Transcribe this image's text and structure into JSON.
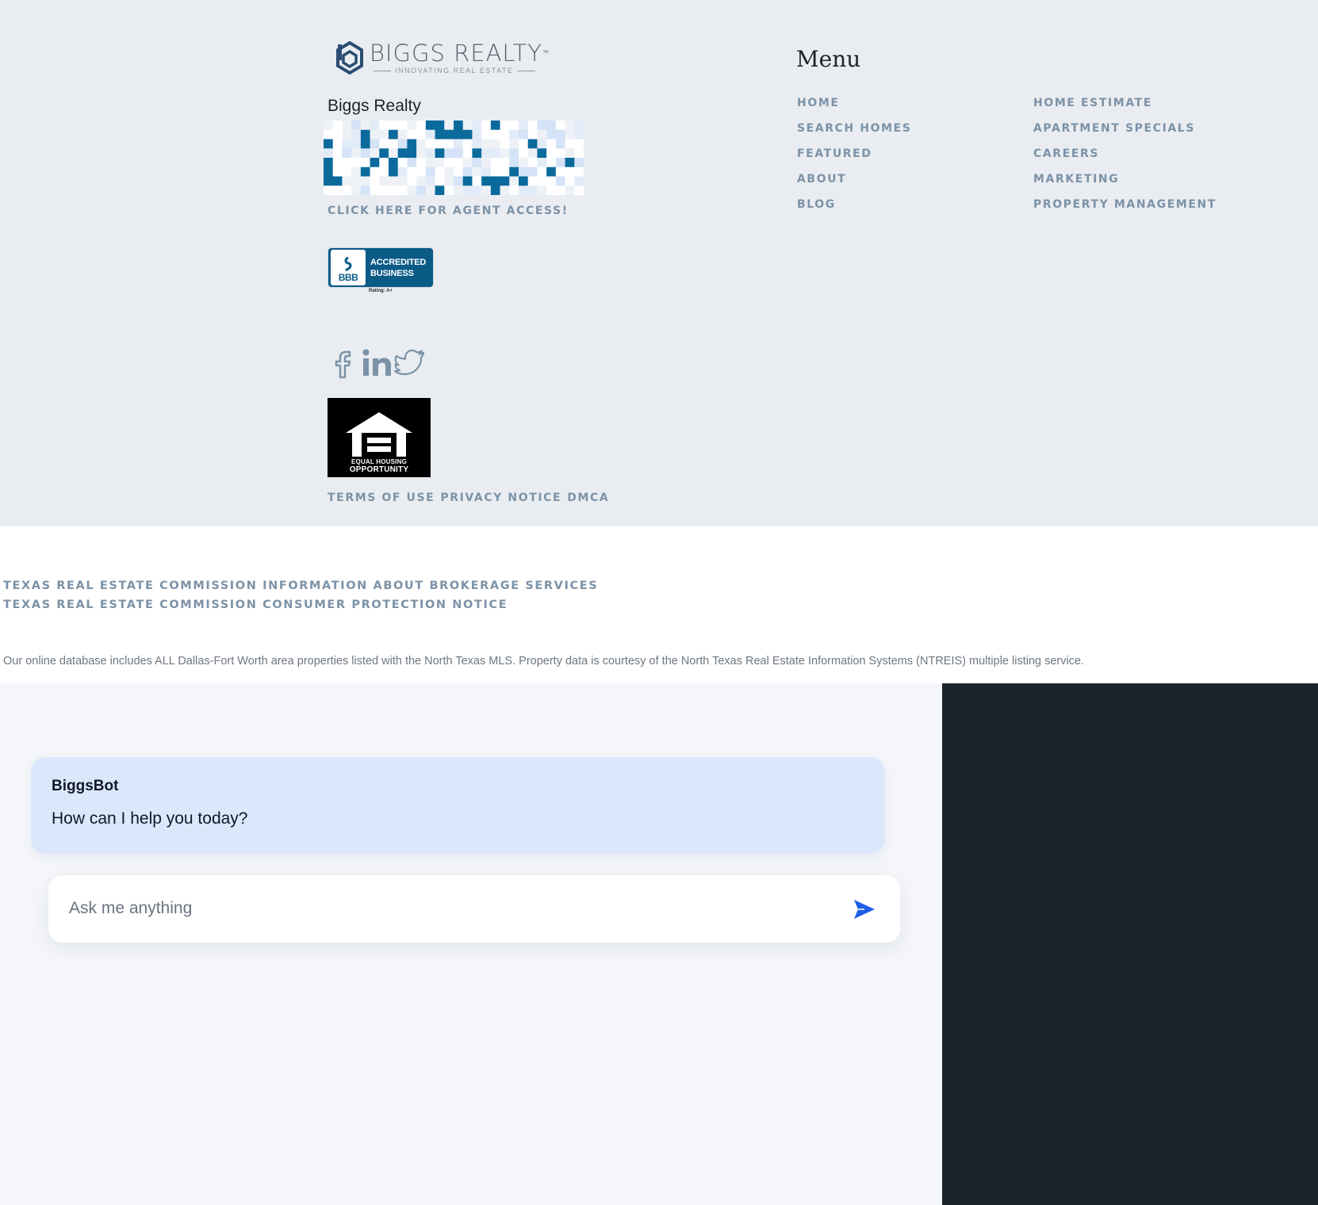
{
  "brand": {
    "logo_name": "BIGGS REALTY",
    "logo_trademark": "™",
    "logo_tagline": "INNOVATING REAL ESTATE",
    "company_name": "Biggs Realty",
    "colors": {
      "brand_blue": "#0b6a9c",
      "link": "#7c92a7",
      "footer_bg": "#e9edf1"
    }
  },
  "footer": {
    "agent_access": "CLICK HERE FOR AGENT ACCESS!",
    "bbb": {
      "line1": "ACCREDITED",
      "line2": "BUSINESS",
      "seal": "BBB",
      "rating": "Rating: A+"
    },
    "social": [
      {
        "icon": "facebook-icon"
      },
      {
        "icon": "linkedin-icon"
      },
      {
        "icon": "twitter-icon"
      }
    ],
    "eho": {
      "line1": "EQUAL HOUSING",
      "line2": "OPPORTUNITY"
    },
    "legal": [
      "TERMS OF USE",
      "PRIVACY NOTICE",
      "DMCA"
    ]
  },
  "menu": {
    "title": "Menu",
    "column1": [
      "HOME",
      "SEARCH HOMES",
      "FEATURED",
      "ABOUT",
      "BLOG"
    ],
    "column2": [
      "HOME ESTIMATE",
      "APARTMENT SPECIALS",
      "CAREERS",
      "MARKETING",
      "PROPERTY MANAGEMENT"
    ]
  },
  "regulatory": {
    "trec_links": [
      "TEXAS REAL ESTATE COMMISSION INFORMATION ABOUT BROKERAGE SERVICES",
      "TEXAS REAL ESTATE COMMISSION CONSUMER PROTECTION NOTICE"
    ],
    "disclaimer": "Our online database includes ALL Dallas-Fort Worth area properties listed with the North Texas MLS. Property data is courtesy of the North Texas Real Estate Information Systems (NTREIS) multiple listing service."
  },
  "chat": {
    "bot_name": "BiggsBot",
    "bot_message": "How can I help you today?",
    "input_placeholder": "Ask me anything",
    "input_value": "",
    "send_icon": "send-icon",
    "colors": {
      "bubble": "#dbe8fc",
      "send": "#1d5ee6",
      "panel": "#1d232b"
    }
  }
}
